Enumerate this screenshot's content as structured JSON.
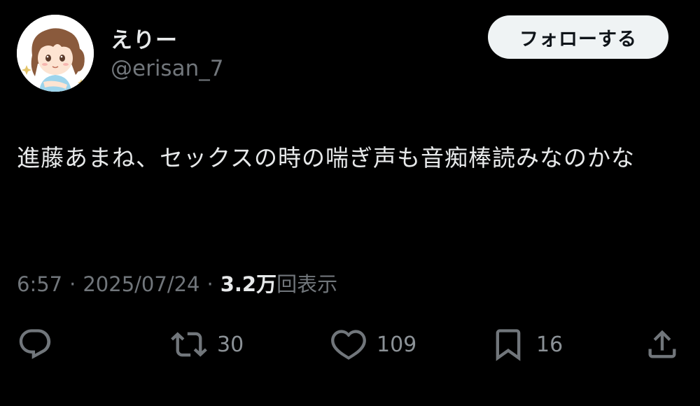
{
  "author": {
    "display_name": "えりー",
    "handle": "@erisan_7"
  },
  "follow_button": {
    "label": "フォローする"
  },
  "tweet": {
    "text": "進藤あまね、セックスの時の喘ぎ声も音痴棒読みなのかな"
  },
  "meta": {
    "time": "6:57",
    "separator": "·",
    "date": "2025/07/24",
    "views_count": "3.2万",
    "views_label": "回表示"
  },
  "actions": {
    "reply": {
      "icon": "reply-icon",
      "count": ""
    },
    "retweet": {
      "icon": "retweet-icon",
      "count": "30"
    },
    "like": {
      "icon": "heart-icon",
      "count": "109"
    },
    "bookmark": {
      "icon": "bookmark-icon",
      "count": "16"
    },
    "share": {
      "icon": "share-icon"
    }
  },
  "colors": {
    "background": "#000000",
    "text_primary": "#e7e9ea",
    "text_secondary": "#71767b",
    "follow_bg": "#eff3f4"
  }
}
